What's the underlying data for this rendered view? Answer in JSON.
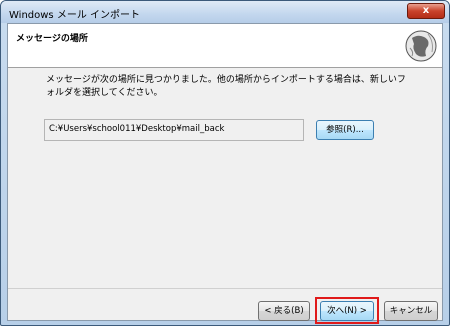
{
  "window": {
    "title": "Windows メール インポート",
    "close_label": "x"
  },
  "header": {
    "title": "メッセージの場所",
    "image_icon": "wizard-globe-icon"
  },
  "content": {
    "description": "メッセージが次の場所に見つかりました。他の場所からインポートする場合は、新しいフォルダを選択してください。",
    "path": "C:¥Users¥school011¥Desktop¥mail_back",
    "browse_label": "参照(R)..."
  },
  "footer": {
    "back_label": "< 戻る(B)",
    "next_label": "次へ(N) >",
    "cancel_label": "キャンセル"
  },
  "colors": {
    "highlight": "#e01a1a",
    "accent": "#3c7fb1"
  }
}
